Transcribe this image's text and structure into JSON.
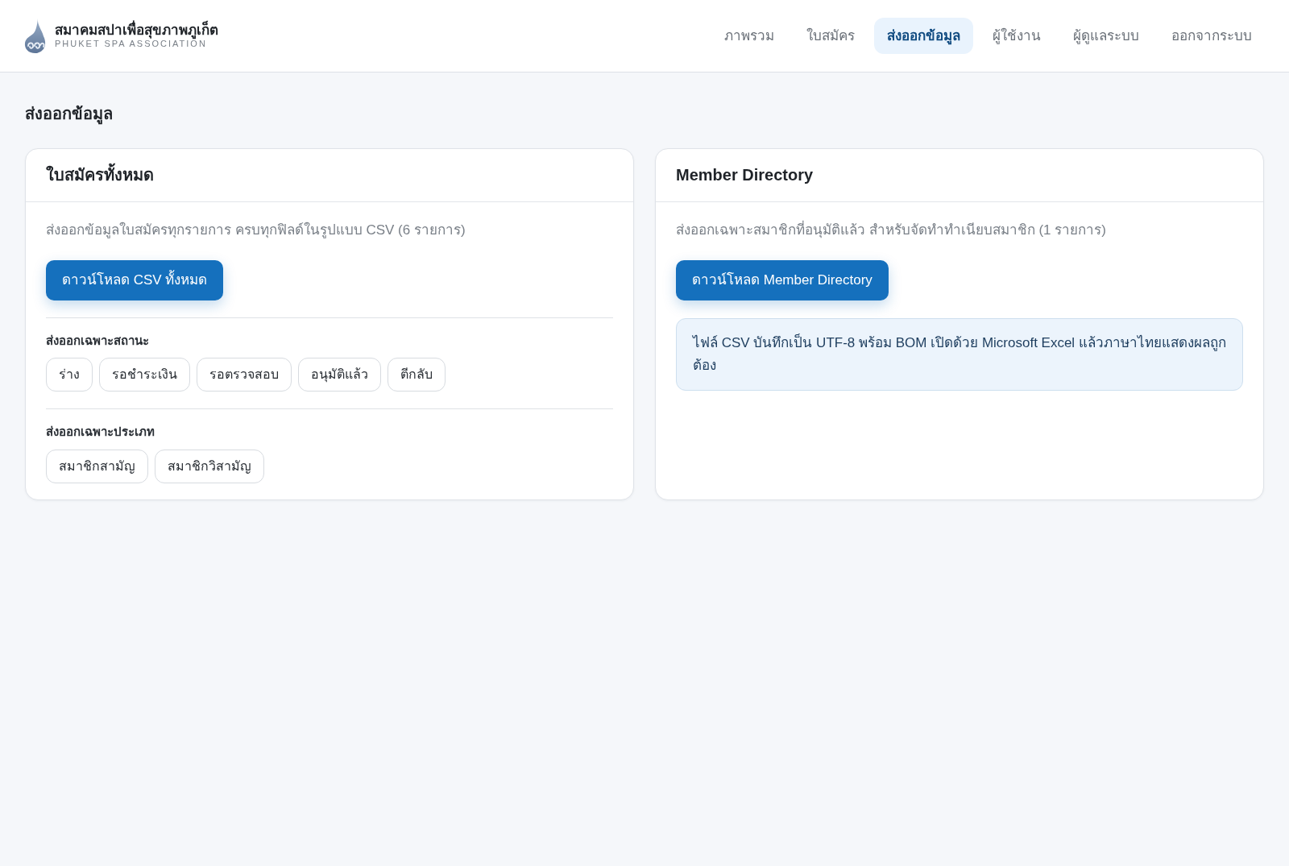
{
  "header": {
    "title": "สมาคมสปาเพื่อสุขภาพภูเก็ต",
    "subtitle": "PHUKET SPA ASSOCIATION"
  },
  "nav": [
    {
      "label": "ภาพรวม",
      "selected": false
    },
    {
      "label": "ใบสมัคร",
      "selected": false
    },
    {
      "label": "ส่งออกข้อมูล",
      "selected": true
    },
    {
      "label": "ผู้ใช้งาน",
      "selected": false
    },
    {
      "label": "ผู้ดูแลระบบ",
      "selected": false
    },
    {
      "label": "ออกจากระบบ",
      "selected": false
    }
  ],
  "page_title": "ส่งออกข้อมูล",
  "cards": [
    {
      "title": "ใบสมัครทั้งหมด",
      "description": "ส่งออกข้อมูลใบสมัครทุกรายการ ครบทุกฟิลด์ในรูปแบบ CSV (6 รายการ)",
      "button": "ดาวน์โหลด CSV ทั้งหมด",
      "sections": [
        {
          "label": "ส่งออกเฉพาะสถานะ",
          "options": [
            "ร่าง",
            "รอชำระเงิน",
            "รอตรวจสอบ",
            "อนุมัติแล้ว",
            "ตีกลับ"
          ]
        },
        {
          "label": "ส่งออกเฉพาะประเภท",
          "options": [
            "สมาชิกสามัญ",
            "สมาชิกวิสามัญ"
          ]
        }
      ]
    },
    {
      "title": "Member Directory",
      "description": "ส่งออกเฉพาะสมาชิกที่อนุมัติแล้ว สำหรับจัดทำทำเนียบสมาชิก (1 รายการ)",
      "button": "ดาวน์โหลด Member Directory",
      "note": "ไฟล์ CSV บันทึกเป็น UTF-8 พร้อม BOM เปิดด้วย Microsoft Excel แล้วภาษาไทยแสดงผลถูกต้อง"
    }
  ]
}
